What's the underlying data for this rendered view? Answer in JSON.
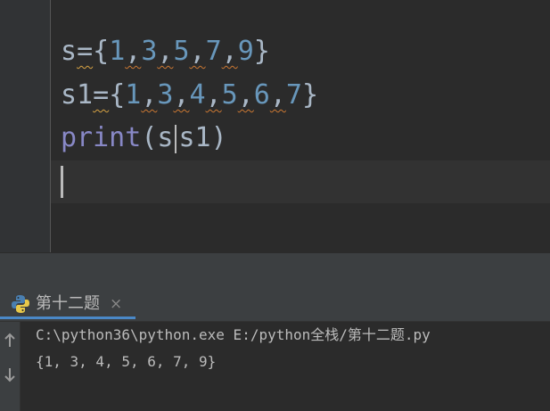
{
  "editor": {
    "line1": {
      "name": "s",
      "op": "=",
      "open": "{",
      "close": "}",
      "nums": [
        "1",
        "3",
        "5",
        "7",
        "9"
      ]
    },
    "line2": {
      "name": "s1",
      "op": "=",
      "open": "{",
      "close": "}",
      "nums": [
        "1",
        "3",
        "4",
        "5",
        "6",
        "7"
      ]
    },
    "line3": {
      "func": "print",
      "open": "(",
      "arg1": "s",
      "arg2": "s1",
      "close": ")"
    }
  },
  "run_panel": {
    "tab_label": "第十二题",
    "tab_close": "×",
    "icons": [
      "python-icon",
      "arrow-up-icon",
      "arrow-down-icon",
      "close-icon"
    ],
    "output": {
      "command": "C:\\python36\\python.exe E:/python全栈/第十二题.py",
      "result": "{1, 3, 4, 5, 6, 7, 9}"
    }
  },
  "colors": {
    "background": "#2b2b2b",
    "number": "#6897bb",
    "function": "#8888c6",
    "text": "#a9b7c6",
    "tab_underline": "#4a88c7"
  }
}
